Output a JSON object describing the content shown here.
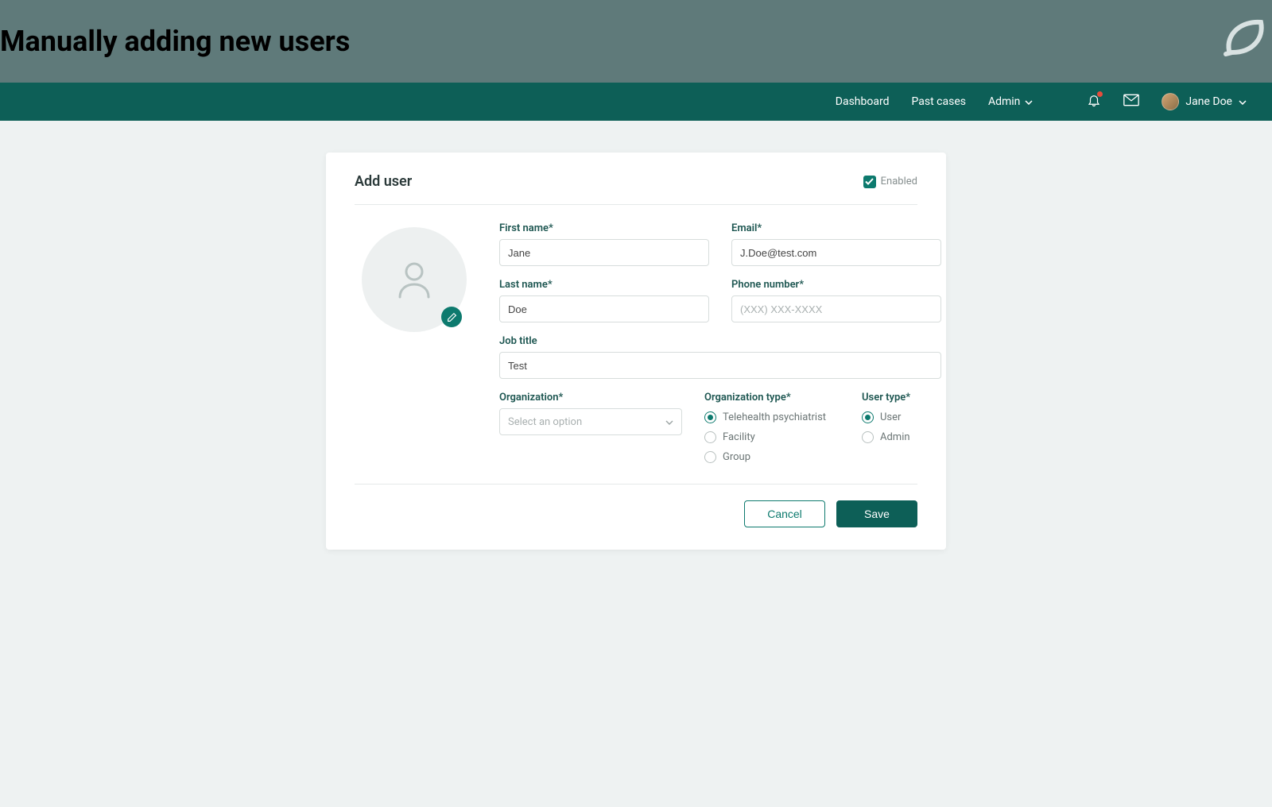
{
  "banner": {
    "title": "Manually adding new users"
  },
  "nav": {
    "items": [
      {
        "label": "Dashboard"
      },
      {
        "label": "Past cases"
      },
      {
        "label": "Admin"
      }
    ],
    "user_name": "Jane Doe"
  },
  "card": {
    "title": "Add user",
    "enabled_label": "Enabled",
    "enabled_checked": true
  },
  "form": {
    "first_name": {
      "label": "First name*",
      "value": "Jane"
    },
    "last_name": {
      "label": "Last name*",
      "value": "Doe"
    },
    "email": {
      "label": "Email*",
      "value": "J.Doe@test.com"
    },
    "phone": {
      "label": "Phone number*",
      "placeholder": "(XXX) XXX-XXXX",
      "value": ""
    },
    "job_title": {
      "label": "Job title",
      "value": "Test"
    },
    "organization": {
      "label": "Organization*",
      "placeholder": "Select an option"
    },
    "org_type": {
      "label": "Organization type*",
      "options": [
        {
          "label": "Telehealth psychiatrist",
          "checked": true
        },
        {
          "label": "Facility",
          "checked": false
        },
        {
          "label": "Group",
          "checked": false
        }
      ]
    },
    "user_type": {
      "label": "User type*",
      "options": [
        {
          "label": "User",
          "checked": true
        },
        {
          "label": "Admin",
          "checked": false
        }
      ]
    }
  },
  "actions": {
    "cancel": "Cancel",
    "save": "Save"
  }
}
